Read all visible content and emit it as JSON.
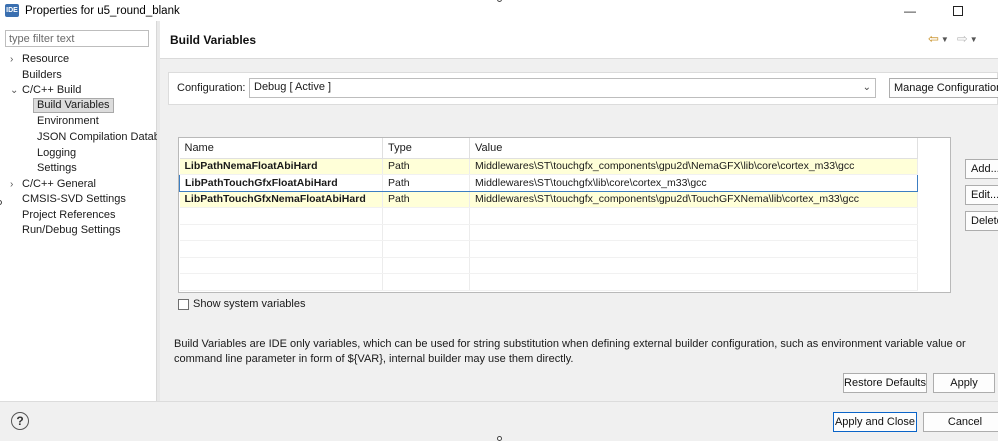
{
  "window": {
    "icon_text": "IDE",
    "title": "Properties for u5_round_blank",
    "minimize_glyph": "—"
  },
  "filter": {
    "placeholder": "type filter text"
  },
  "tree": [
    {
      "label": "Resource",
      "chev": "›"
    },
    {
      "label": "Builders",
      "chev": ""
    },
    {
      "label": "C/C++ Build",
      "chev": "⌄"
    },
    {
      "label": "Build Variables",
      "chev": ""
    },
    {
      "label": "Environment",
      "chev": ""
    },
    {
      "label": "JSON Compilation Datab",
      "chev": ""
    },
    {
      "label": "Logging",
      "chev": ""
    },
    {
      "label": "Settings",
      "chev": ""
    },
    {
      "label": "C/C++ General",
      "chev": "›"
    },
    {
      "label": "CMSIS-SVD Settings",
      "chev": ""
    },
    {
      "label": "Project References",
      "chev": ""
    },
    {
      "label": "Run/Debug Settings",
      "chev": ""
    }
  ],
  "page": {
    "title": "Build Variables",
    "back_arrow": "⇦",
    "forward_arrow": "⇨",
    "dropdown_glyph": "▼"
  },
  "config": {
    "label": "Configuration:",
    "value": "Debug  [ Active ]",
    "caret": "⌄",
    "manage_label": "Manage Configurations..."
  },
  "table": {
    "headers": [
      "Name",
      "Type",
      "Value"
    ],
    "rows": [
      {
        "name": "LibPathNemaFloatAbiHard",
        "type": "Path",
        "value": "Middlewares\\ST\\touchgfx_components\\gpu2d\\NemaGFX\\lib\\core\\cortex_m33\\gcc"
      },
      {
        "name": "LibPathTouchGfxFloatAbiHard",
        "type": "Path",
        "value": "Middlewares\\ST\\touchgfx\\lib\\core\\cortex_m33\\gcc"
      },
      {
        "name": "LibPathTouchGfxNemaFloatAbiHard",
        "type": "Path",
        "value": "Middlewares\\ST\\touchgfx_components\\gpu2d\\TouchGFXNema\\lib\\cortex_m33\\gcc"
      }
    ]
  },
  "side_buttons": {
    "add": "Add...",
    "edit": "Edit...",
    "delete": "Delete"
  },
  "show_system": {
    "label": "Show system variables"
  },
  "description": "Build Variables are IDE only variables, which can be used for string substitution when defining external builder configuration, such as environment variable value or command line parameter in form of ${VAR}, internal builder may use them directly.",
  "buttons": {
    "restore": "Restore Defaults",
    "apply": "Apply",
    "apply_close": "Apply and Close",
    "cancel": "Cancel",
    "help": "?"
  }
}
